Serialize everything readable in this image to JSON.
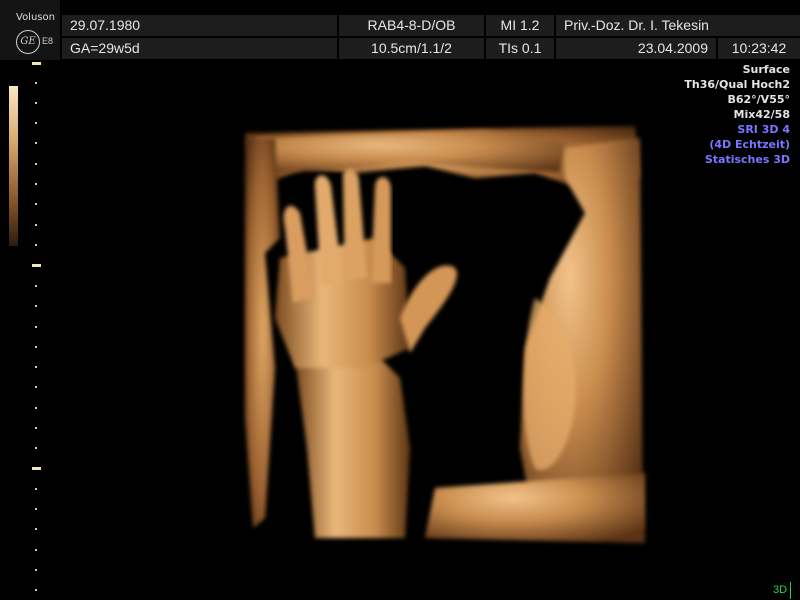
{
  "header": {
    "brand": "Voluson",
    "logo": "GE",
    "model": "E8",
    "patient_dob": "29.07.1980",
    "gestational_age": "GA=29w5d",
    "probe": "RAB4-8-D/OB",
    "depth_info": "10.5cm/1.1/2",
    "mi": "MI  1.2",
    "tis": "TIs  0.1",
    "physician": "Priv.-Doz. Dr. I.  Tekesin",
    "date": "23.04.2009",
    "time": "10:23:42"
  },
  "info_panel": {
    "lines": [
      "Surface",
      "Th36/Qual Hoch2",
      "B62°/V55°",
      "Mix42/58"
    ],
    "blue_lines": [
      "SRI 3D 4",
      "(4D Echtzeit)",
      "Statisches 3D"
    ]
  },
  "mode_badge": "3D",
  "colors": {
    "header_cell": "#1d1d1d",
    "info_blue": "#7a76ff",
    "mode_green": "#2fd05a",
    "tissue": "#c98c4e"
  },
  "icons": {
    "ge_logo": "ge-logo-icon"
  }
}
